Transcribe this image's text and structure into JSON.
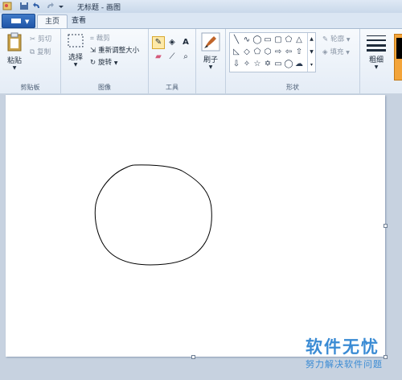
{
  "window": {
    "title": "无标题 - 画图"
  },
  "tabs": [
    {
      "label": "主页"
    },
    {
      "label": "查看"
    }
  ],
  "clipboard": {
    "paste_label": "粘贴",
    "cut_label": "剪切",
    "copy_label": "复制",
    "group_label": "剪贴板"
  },
  "image": {
    "select_label": "选择",
    "crop_label": "裁剪",
    "resize_label": "重新调整大小",
    "rotate_label": "旋转",
    "group_label": "图像"
  },
  "tools": {
    "group_label": "工具",
    "text_glyph": "A"
  },
  "brushes": {
    "label": "刷子"
  },
  "shapes": {
    "outline_label": "轮廓",
    "fill_label": "填充",
    "group_label": "形状"
  },
  "size": {
    "label": "粗细"
  },
  "watermark": {
    "title": "软件无忧",
    "subtitle": "努力解决软件问题"
  },
  "colors": {
    "accent": "#3a8bd4",
    "ribbon_bg": "#eaf0f8",
    "canvas_bg": "#ffffff",
    "workspace": "#c7d2e0"
  }
}
